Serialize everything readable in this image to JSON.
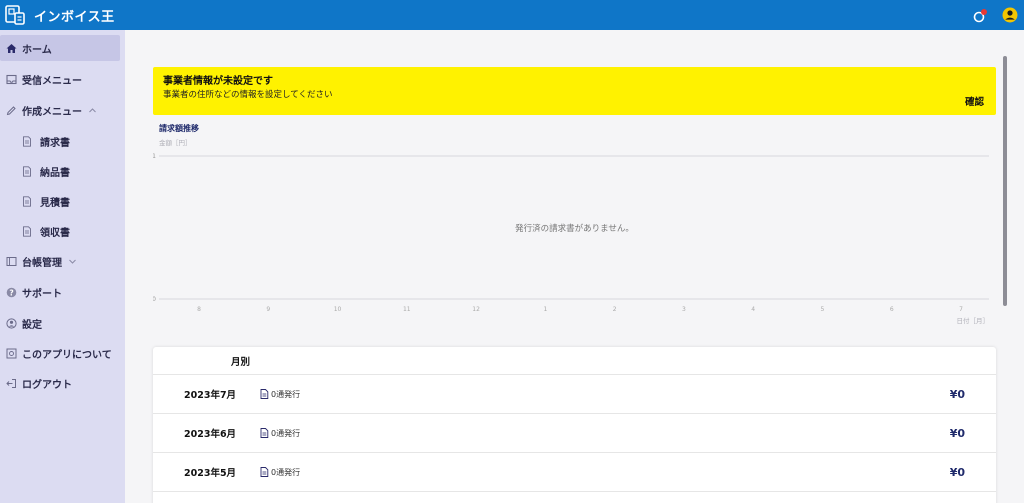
{
  "header": {
    "app_title": "インボイス王",
    "colors": {
      "bar": "#0f76c8",
      "sidebar": "#dcdcf2",
      "banner": "#fff200",
      "accent": "#1f2a6b"
    }
  },
  "sidebar": {
    "items": [
      {
        "label": "ホーム",
        "icon": "home-icon",
        "active": true
      },
      {
        "label": "受信メニュー",
        "icon": "inbox-icon"
      },
      {
        "label": "作成メニュー",
        "icon": "pencil-icon",
        "expanded": true
      },
      {
        "label": "請求書",
        "icon": "document-icon"
      },
      {
        "label": "納品書",
        "icon": "document-icon"
      },
      {
        "label": "見積書",
        "icon": "document-icon"
      },
      {
        "label": "領収書",
        "icon": "document-icon"
      },
      {
        "label": "台帳管理",
        "icon": "ledger-icon",
        "expanded": false
      },
      {
        "label": "サポート",
        "icon": "help-icon"
      },
      {
        "label": "設定",
        "icon": "settings-icon"
      },
      {
        "label": "このアプリについて",
        "icon": "info-icon"
      },
      {
        "label": "ログアウト",
        "icon": "logout-icon"
      }
    ]
  },
  "banner": {
    "title": "事業者情報が未設定です",
    "text": "事業者の住所などの情報を設定してください",
    "confirm_label": "確認"
  },
  "chart": {
    "title": "請求額推移",
    "empty_message": "発行済の請求書がありません。"
  },
  "chart_data": {
    "type": "line",
    "title": "請求額推移",
    "ylabel": "金額［円］",
    "xlabel": "日付［月］",
    "categories": [
      "8",
      "9",
      "10",
      "11",
      "12",
      "1",
      "2",
      "3",
      "4",
      "5",
      "6",
      "7"
    ],
    "ylim": [
      0,
      1
    ],
    "yticks": [
      "0",
      "1"
    ],
    "series": []
  },
  "monthly": {
    "header_label": "月別",
    "rows": [
      {
        "month": "2023年7月",
        "count": "0通発行",
        "amount": "¥0"
      },
      {
        "month": "2023年6月",
        "count": "0通発行",
        "amount": "¥0"
      },
      {
        "month": "2023年5月",
        "count": "0通発行",
        "amount": "¥0"
      }
    ]
  }
}
